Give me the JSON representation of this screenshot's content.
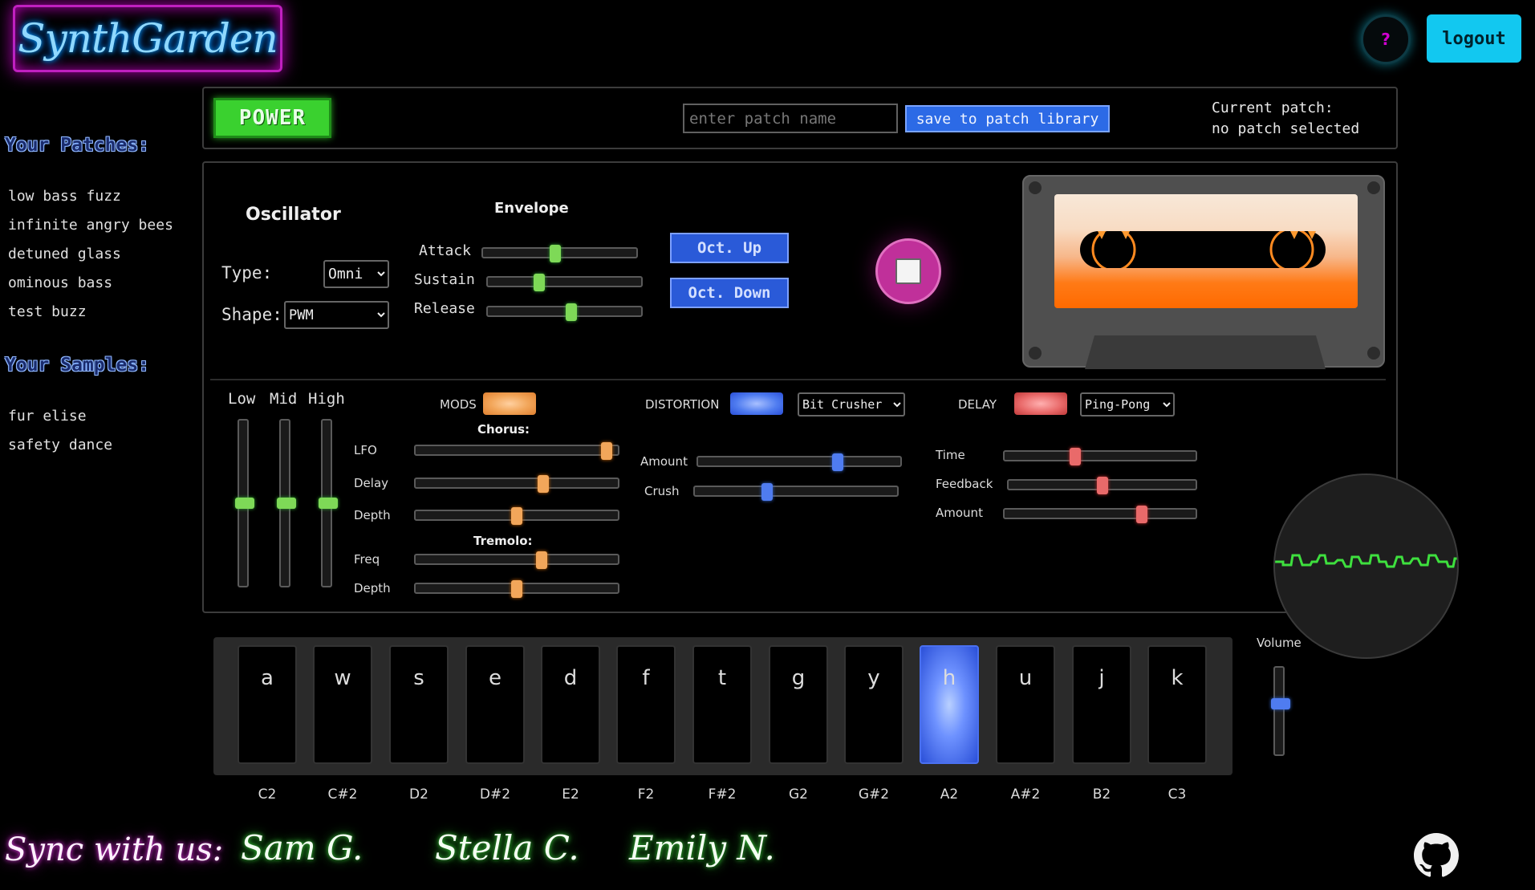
{
  "app": {
    "logo_text": "SynthGarden"
  },
  "header": {
    "help_label": "?",
    "logout_label": "logout"
  },
  "sidebar": {
    "patches_heading": "Your Patches:",
    "patches": [
      "low bass fuzz",
      "infinite angry bees",
      "detuned glass",
      "ominous bass",
      "test buzz"
    ],
    "samples_heading": "Your Samples:",
    "samples": [
      "fur elise",
      "safety dance"
    ]
  },
  "patch_bar": {
    "power_label": "POWER",
    "patch_name_placeholder": "enter patch name",
    "save_label": "save to patch library",
    "current_patch_label": "Current patch:",
    "current_patch_value": "no patch selected"
  },
  "oscillator": {
    "title": "Oscillator",
    "type_label": "Type:",
    "type_value": "Omni",
    "shape_label": "Shape:",
    "shape_value": "PWM"
  },
  "envelope": {
    "title": "Envelope",
    "sliders": [
      {
        "label": "Attack",
        "value": 0.47
      },
      {
        "label": "Sustain",
        "value": 0.32
      },
      {
        "label": "Release",
        "value": 0.55
      }
    ]
  },
  "octave": {
    "up_label": "Oct. Up",
    "down_label": "Oct. Down"
  },
  "eq": {
    "labels": [
      "Low",
      "Mid",
      "High"
    ],
    "values": [
      0.5,
      0.5,
      0.5
    ]
  },
  "mods": {
    "label": "MODS",
    "chorus_title": "Chorus:",
    "chorus": [
      {
        "label": "LFO",
        "value": 0.97
      },
      {
        "label": "Delay",
        "value": 0.64
      },
      {
        "label": "Depth",
        "value": 0.5
      }
    ],
    "tremolo_title": "Tremolo:",
    "tremolo": [
      {
        "label": "Freq",
        "value": 0.63
      },
      {
        "label": "Depth",
        "value": 0.5
      }
    ],
    "color": "#f2a65a"
  },
  "distortion": {
    "label": "DISTORTION",
    "type_value": "Bit Crusher",
    "sliders": [
      {
        "label": "Amount",
        "value": 0.7
      },
      {
        "label": "Crush",
        "value": 0.35
      }
    ],
    "color": "#4f7cf0"
  },
  "delay": {
    "label": "DELAY",
    "type_value": "Ping-Pong",
    "sliders": [
      {
        "label": "Time",
        "value": 0.36
      },
      {
        "label": "Feedback",
        "value": 0.5
      },
      {
        "label": "Amount",
        "value": 0.73
      }
    ],
    "color": "#e96a6a"
  },
  "keyboard": {
    "keys": [
      {
        "key": "a",
        "note": "C2"
      },
      {
        "key": "w",
        "note": "C#2"
      },
      {
        "key": "s",
        "note": "D2"
      },
      {
        "key": "e",
        "note": "D#2"
      },
      {
        "key": "d",
        "note": "E2"
      },
      {
        "key": "f",
        "note": "F2"
      },
      {
        "key": "t",
        "note": "F#2"
      },
      {
        "key": "g",
        "note": "G2"
      },
      {
        "key": "y",
        "note": "G#2"
      },
      {
        "key": "h",
        "note": "A2"
      },
      {
        "key": "u",
        "note": "A#2"
      },
      {
        "key": "j",
        "note": "B2"
      },
      {
        "key": "k",
        "note": "C3"
      }
    ],
    "active_key": "h"
  },
  "volume": {
    "label": "Volume",
    "value": 0.6
  },
  "footer": {
    "sync_label": "Sync with us:",
    "members": [
      "Sam G.",
      "Stella C.",
      "Emily N."
    ]
  },
  "icons": {
    "github": "github-icon",
    "stop": "stop-icon"
  }
}
